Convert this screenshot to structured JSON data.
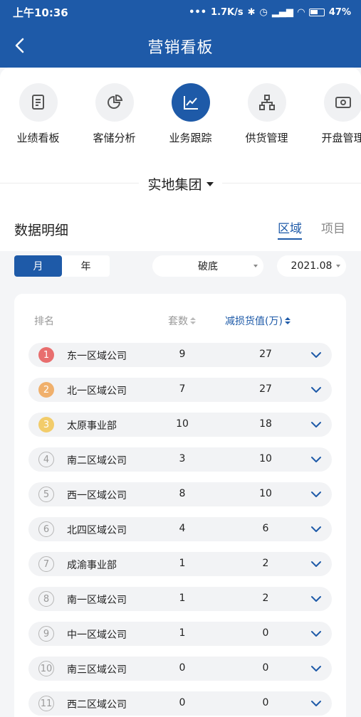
{
  "status": {
    "time": "上午10:36",
    "net": "1.7K/s",
    "battery": "47%"
  },
  "nav": {
    "title": "营销看板"
  },
  "menu": [
    {
      "label": "业绩看板",
      "icon": "report-icon",
      "active": false
    },
    {
      "label": "客储分析",
      "icon": "pie-chart-icon",
      "active": false
    },
    {
      "label": "业务跟踪",
      "icon": "line-chart-icon",
      "active": true
    },
    {
      "label": "供货管理",
      "icon": "org-chart-icon",
      "active": false
    },
    {
      "label": "开盘管理",
      "icon": "cash-icon",
      "active": false
    }
  ],
  "group": {
    "label": "实地集团"
  },
  "section": {
    "title": "数据明细",
    "tab_region": "区域",
    "tab_project": "项目"
  },
  "filters": {
    "month": "月",
    "year": "年",
    "type": "破底",
    "date": "2021.08"
  },
  "table": {
    "headers": {
      "rank": "排名",
      "sets": "套数",
      "value": "减损货值(万)"
    },
    "rows": [
      {
        "rank": "1",
        "name": "东一区域公司",
        "sets": "9",
        "value": "27"
      },
      {
        "rank": "2",
        "name": "北一区域公司",
        "sets": "7",
        "value": "27"
      },
      {
        "rank": "3",
        "name": "太原事业部",
        "sets": "10",
        "value": "18"
      },
      {
        "rank": "4",
        "name": "南二区域公司",
        "sets": "3",
        "value": "10"
      },
      {
        "rank": "5",
        "name": "西一区域公司",
        "sets": "8",
        "value": "10"
      },
      {
        "rank": "6",
        "name": "北四区域公司",
        "sets": "4",
        "value": "6"
      },
      {
        "rank": "7",
        "name": "成渝事业部",
        "sets": "1",
        "value": "2"
      },
      {
        "rank": "8",
        "name": "南一区域公司",
        "sets": "1",
        "value": "2"
      },
      {
        "rank": "9",
        "name": "中一区域公司",
        "sets": "1",
        "value": "0"
      },
      {
        "rank": "10",
        "name": "南三区域公司",
        "sets": "0",
        "value": "0"
      },
      {
        "rank": "11",
        "name": "西二区域公司",
        "sets": "0",
        "value": "0"
      }
    ]
  },
  "colors": {
    "primary": "#1e5aa8",
    "rank1": "#e86e6e",
    "rank2": "#f0b06c",
    "rank3": "#f2cc6a"
  }
}
